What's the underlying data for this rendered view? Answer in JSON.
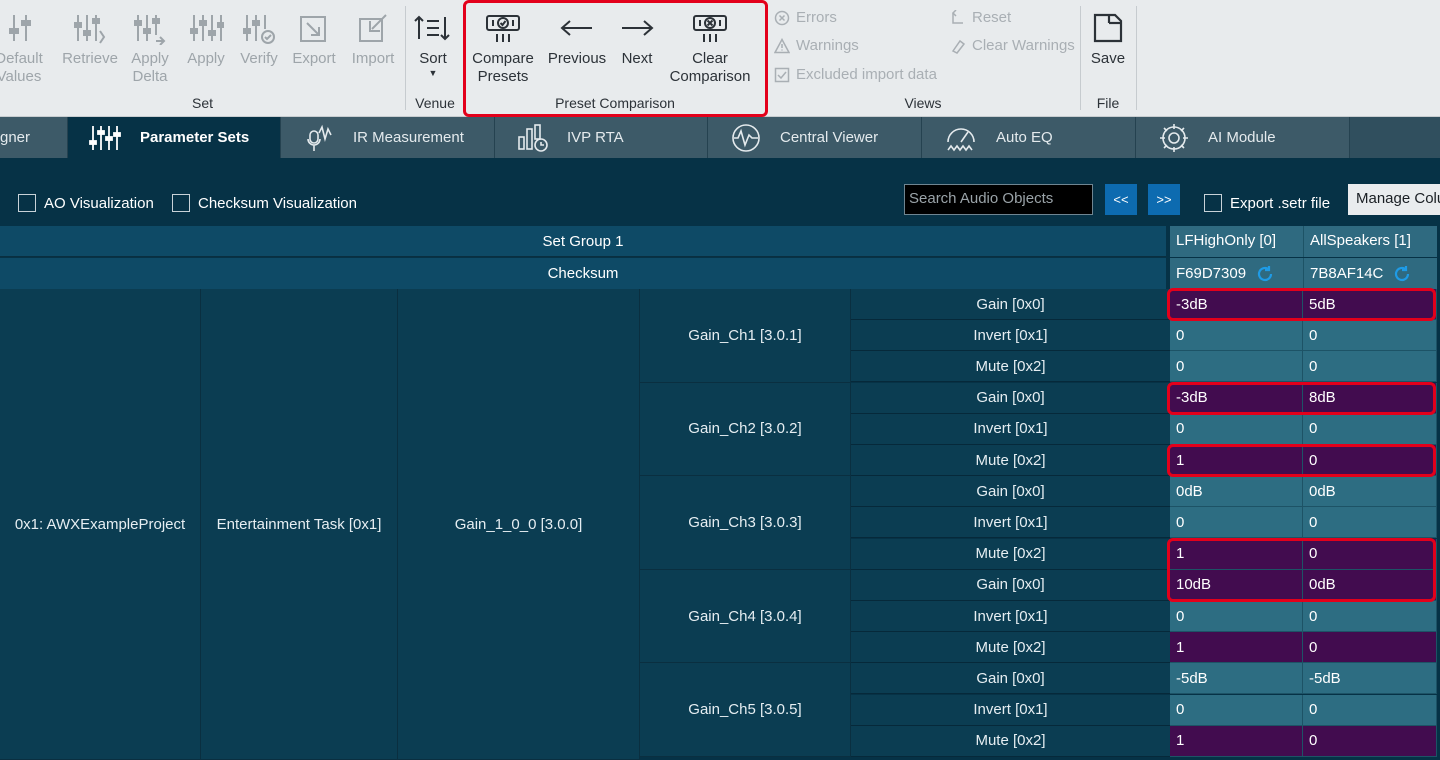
{
  "ribbon": {
    "set_group": {
      "label": "Set",
      "buttons": [
        {
          "name": "default-values",
          "label": "Default\nValues"
        },
        {
          "name": "retrieve",
          "label": "Retrieve"
        },
        {
          "name": "apply-delta",
          "label": "Apply\nDelta"
        },
        {
          "name": "apply",
          "label": "Apply"
        },
        {
          "name": "verify",
          "label": "Verify"
        },
        {
          "name": "export",
          "label": "Export"
        },
        {
          "name": "import",
          "label": "Import"
        }
      ]
    },
    "venue_group": {
      "label": "Venue",
      "sort_label": "Sort"
    },
    "preset_group": {
      "label": "Preset Comparison",
      "compare_label": "Compare\nPresets",
      "previous_label": "Previous",
      "next_label": "Next",
      "clear_label": "Clear\nComparison"
    },
    "views_group": {
      "label": "Views",
      "errors": "Errors",
      "warnings": "Warnings",
      "excluded": "Excluded import data",
      "reset": "Reset",
      "clear_warnings": "Clear Warnings"
    },
    "file_group": {
      "label": "File",
      "save_label": "Save"
    }
  },
  "tabs": {
    "partial": "gner",
    "parameter_sets": "Parameter Sets",
    "ir_measurement": "IR Measurement",
    "ivp_rta": "IVP RTA",
    "central_viewer": "Central Viewer",
    "auto_eq": "Auto EQ",
    "ai_module": "AI Module"
  },
  "toolbar": {
    "ao_visualization": "AO Visualization",
    "checksum_visualization": "Checksum Visualization",
    "search_placeholder": "Search Audio Objects",
    "prev_btn": "<<",
    "next_btn": ">>",
    "export_setr": "Export .setr file",
    "manage_columns": "Manage Colu"
  },
  "grid": {
    "set_group": "Set Group 1",
    "checksum": "Checksum",
    "columns": [
      {
        "name": "LFHighOnly [0]",
        "checksum": "F69D7309"
      },
      {
        "name": "AllSpeakers [1]",
        "checksum": "7B8AF14C"
      }
    ],
    "project": "0x1: AWXExampleProject",
    "task": "Entertainment Task [0x1]",
    "block": "Gain_1_0_0 [3.0.0]",
    "channels": [
      {
        "label": "Gain_Ch1 [3.0.1]",
        "params": [
          {
            "label": "Gain [0x0]",
            "v1": "-3dB",
            "v2": "5dB",
            "diff": true
          },
          {
            "label": "Invert [0x1]",
            "v1": "0",
            "v2": "0",
            "diff": false
          },
          {
            "label": "Mute [0x2]",
            "v1": "0",
            "v2": "0",
            "diff": false
          }
        ]
      },
      {
        "label": "Gain_Ch2 [3.0.2]",
        "params": [
          {
            "label": "Gain [0x0]",
            "v1": "-3dB",
            "v2": "8dB",
            "diff": true
          },
          {
            "label": "Invert [0x1]",
            "v1": "0",
            "v2": "0",
            "diff": false
          },
          {
            "label": "Mute [0x2]",
            "v1": "1",
            "v2": "0",
            "diff": true
          }
        ]
      },
      {
        "label": "Gain_Ch3 [3.0.3]",
        "params": [
          {
            "label": "Gain [0x0]",
            "v1": "0dB",
            "v2": "0dB",
            "diff": false
          },
          {
            "label": "Invert [0x1]",
            "v1": "0",
            "v2": "0",
            "diff": false
          },
          {
            "label": "Mute [0x2]",
            "v1": "1",
            "v2": "0",
            "diff": true
          }
        ]
      },
      {
        "label": "Gain_Ch4 [3.0.4]",
        "params": [
          {
            "label": "Gain [0x0]",
            "v1": "10dB",
            "v2": "0dB",
            "diff": true
          },
          {
            "label": "Invert [0x1]",
            "v1": "0",
            "v2": "0",
            "diff": false
          },
          {
            "label": "Mute [0x2]",
            "v1": "1",
            "v2": "0",
            "diff": true
          }
        ]
      },
      {
        "label": "Gain_Ch5 [3.0.5]",
        "params": [
          {
            "label": "Gain [0x0]",
            "v1": "-5dB",
            "v2": "-5dB",
            "diff": false
          },
          {
            "label": "Invert [0x1]",
            "v1": "0",
            "v2": "0",
            "diff": false
          },
          {
            "label": "Mute [0x2]",
            "v1": "1",
            "v2": "0",
            "diff": true
          }
        ]
      }
    ]
  },
  "colors": {
    "accent": "#0d6bb0",
    "diff_cell": "#420c4f",
    "highlight": "#e3001b",
    "refresh_icon": "#1e9be6"
  }
}
